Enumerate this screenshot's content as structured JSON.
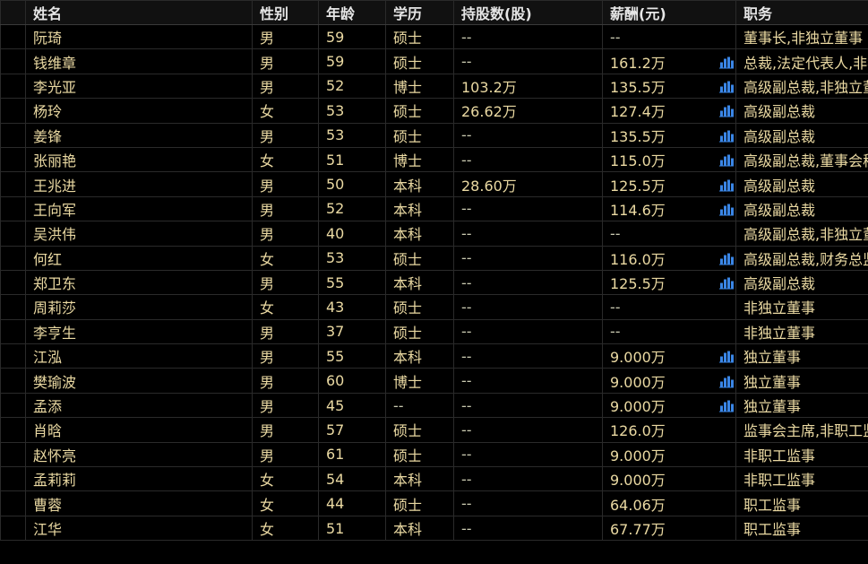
{
  "headers": {
    "name": "姓名",
    "gender": "性别",
    "age": "年龄",
    "education": "学历",
    "shares": "持股数(股)",
    "salary": "薪酬(元)",
    "position": "职务"
  },
  "accent_color": "#3a86e6",
  "rows": [
    {
      "name": "阮琦",
      "gender": "男",
      "age": "59",
      "education": "硕士",
      "shares": "--",
      "salary": "--",
      "has_chart": false,
      "position": "董事长,非独立董事"
    },
    {
      "name": "钱维章",
      "gender": "男",
      "age": "59",
      "education": "硕士",
      "shares": "--",
      "salary": "161.2万",
      "has_chart": true,
      "position": "总裁,法定代表人,非独立董事"
    },
    {
      "name": "李光亚",
      "gender": "男",
      "age": "52",
      "education": "博士",
      "shares": "103.2万",
      "salary": "135.5万",
      "has_chart": true,
      "position": "高级副总裁,非独立董事"
    },
    {
      "name": "杨玲",
      "gender": "女",
      "age": "53",
      "education": "硕士",
      "shares": "26.62万",
      "salary": "127.4万",
      "has_chart": true,
      "position": "高级副总裁"
    },
    {
      "name": "姜锋",
      "gender": "男",
      "age": "53",
      "education": "硕士",
      "shares": "--",
      "salary": "135.5万",
      "has_chart": true,
      "position": "高级副总裁"
    },
    {
      "name": "张丽艳",
      "gender": "女",
      "age": "51",
      "education": "博士",
      "shares": "--",
      "salary": "115.0万",
      "has_chart": true,
      "position": "高级副总裁,董事会秘书"
    },
    {
      "name": "王兆进",
      "gender": "男",
      "age": "50",
      "education": "本科",
      "shares": "28.60万",
      "salary": "125.5万",
      "has_chart": true,
      "position": "高级副总裁"
    },
    {
      "name": "王向军",
      "gender": "男",
      "age": "52",
      "education": "本科",
      "shares": "--",
      "salary": "114.6万",
      "has_chart": true,
      "position": "高级副总裁"
    },
    {
      "name": "吴洪伟",
      "gender": "男",
      "age": "40",
      "education": "本科",
      "shares": "--",
      "salary": "--",
      "has_chart": false,
      "position": "高级副总裁,非独立董事"
    },
    {
      "name": "何红",
      "gender": "女",
      "age": "53",
      "education": "硕士",
      "shares": "--",
      "salary": "116.0万",
      "has_chart": true,
      "position": "高级副总裁,财务总监"
    },
    {
      "name": "郑卫东",
      "gender": "男",
      "age": "55",
      "education": "本科",
      "shares": "--",
      "salary": "125.5万",
      "has_chart": true,
      "position": "高级副总裁"
    },
    {
      "name": "周莉莎",
      "gender": "女",
      "age": "43",
      "education": "硕士",
      "shares": "--",
      "salary": "--",
      "has_chart": false,
      "position": "非独立董事"
    },
    {
      "name": "李亨生",
      "gender": "男",
      "age": "37",
      "education": "硕士",
      "shares": "--",
      "salary": "--",
      "has_chart": false,
      "position": "非独立董事"
    },
    {
      "name": "江泓",
      "gender": "男",
      "age": "55",
      "education": "本科",
      "shares": "--",
      "salary": "9.000万",
      "has_chart": true,
      "position": "独立董事"
    },
    {
      "name": "樊瑜波",
      "gender": "男",
      "age": "60",
      "education": "博士",
      "shares": "--",
      "salary": "9.000万",
      "has_chart": true,
      "position": "独立董事"
    },
    {
      "name": "孟添",
      "gender": "男",
      "age": "45",
      "education": "--",
      "shares": "--",
      "salary": "9.000万",
      "has_chart": true,
      "position": "独立董事"
    },
    {
      "name": "肖晗",
      "gender": "男",
      "age": "57",
      "education": "硕士",
      "shares": "--",
      "salary": "126.0万",
      "has_chart": false,
      "position": "监事会主席,非职工监事"
    },
    {
      "name": "赵怀亮",
      "gender": "男",
      "age": "61",
      "education": "硕士",
      "shares": "--",
      "salary": "9.000万",
      "has_chart": false,
      "position": "非职工监事"
    },
    {
      "name": "孟莉莉",
      "gender": "女",
      "age": "54",
      "education": "本科",
      "shares": "--",
      "salary": "9.000万",
      "has_chart": false,
      "position": "非职工监事"
    },
    {
      "name": "曹蓉",
      "gender": "女",
      "age": "44",
      "education": "硕士",
      "shares": "--",
      "salary": "64.06万",
      "has_chart": false,
      "position": "职工监事"
    },
    {
      "name": "江华",
      "gender": "女",
      "age": "51",
      "education": "本科",
      "shares": "--",
      "salary": "67.77万",
      "has_chart": false,
      "position": "职工监事"
    }
  ]
}
